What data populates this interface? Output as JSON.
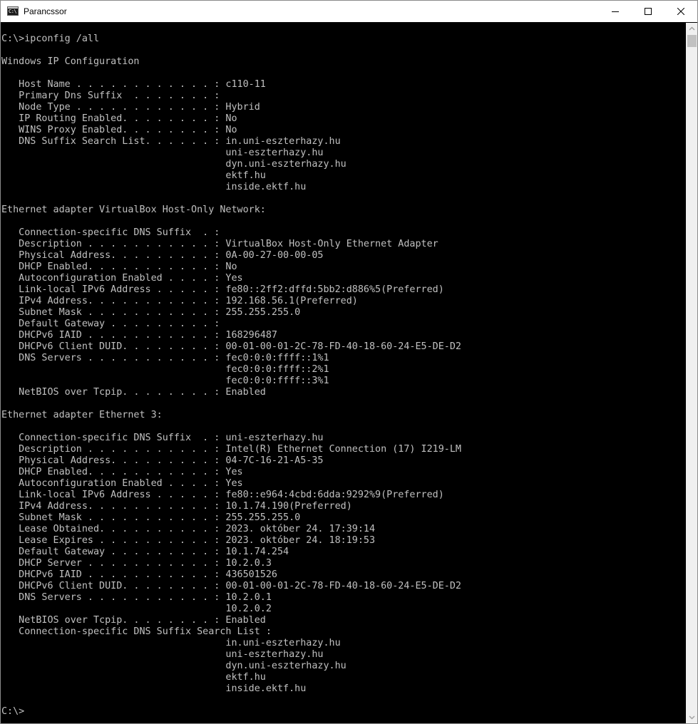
{
  "window": {
    "title": "Parancssor",
    "app_icon_glyph": "C:\\",
    "icons": {
      "minimize": "minimize-icon",
      "maximize": "maximize-icon",
      "close": "close-icon"
    }
  },
  "console": {
    "foreground": "#c0c0c0",
    "background": "#000000",
    "lines": [
      "C:\\>ipconfig /all",
      "",
      "Windows IP Configuration",
      "",
      "   Host Name . . . . . . . . . . . . : c110-11",
      "   Primary Dns Suffix  . . . . . . . : ",
      "   Node Type . . . . . . . . . . . . : Hybrid",
      "   IP Routing Enabled. . . . . . . . : No",
      "   WINS Proxy Enabled. . . . . . . . : No",
      "   DNS Suffix Search List. . . . . . : in.uni-eszterhazy.hu",
      "                                       uni-eszterhazy.hu",
      "                                       dyn.uni-eszterhazy.hu",
      "                                       ektf.hu",
      "                                       inside.ektf.hu",
      "",
      "Ethernet adapter VirtualBox Host-Only Network:",
      "",
      "   Connection-specific DNS Suffix  . : ",
      "   Description . . . . . . . . . . . : VirtualBox Host-Only Ethernet Adapter",
      "   Physical Address. . . . . . . . . : 0A-00-27-00-00-05",
      "   DHCP Enabled. . . . . . . . . . . : No",
      "   Autoconfiguration Enabled . . . . : Yes",
      "   Link-local IPv6 Address . . . . . : fe80::2ff2:dffd:5bb2:d886%5(Preferred)",
      "   IPv4 Address. . . . . . . . . . . : 192.168.56.1(Preferred)",
      "   Subnet Mask . . . . . . . . . . . : 255.255.255.0",
      "   Default Gateway . . . . . . . . . : ",
      "   DHCPv6 IAID . . . . . . . . . . . : 168296487",
      "   DHCPv6 Client DUID. . . . . . . . : 00-01-00-01-2C-78-FD-40-18-60-24-E5-DE-D2",
      "   DNS Servers . . . . . . . . . . . : fec0:0:0:ffff::1%1",
      "                                       fec0:0:0:ffff::2%1",
      "                                       fec0:0:0:ffff::3%1",
      "   NetBIOS over Tcpip. . . . . . . . : Enabled",
      "",
      "Ethernet adapter Ethernet 3:",
      "",
      "   Connection-specific DNS Suffix  . : uni-eszterhazy.hu",
      "   Description . . . . . . . . . . . : Intel(R) Ethernet Connection (17) I219-LM",
      "   Physical Address. . . . . . . . . : 04-7C-16-21-A5-35",
      "   DHCP Enabled. . . . . . . . . . . : Yes",
      "   Autoconfiguration Enabled . . . . : Yes",
      "   Link-local IPv6 Address . . . . . : fe80::e964:4cbd:6dda:9292%9(Preferred)",
      "   IPv4 Address. . . . . . . . . . . : 10.1.74.190(Preferred)",
      "   Subnet Mask . . . . . . . . . . . : 255.255.255.0",
      "   Lease Obtained. . . . . . . . . . : 2023. október 24. 17:39:14",
      "   Lease Expires . . . . . . . . . . : 2023. október 24. 18:19:53",
      "   Default Gateway . . . . . . . . . : 10.1.74.254",
      "   DHCP Server . . . . . . . . . . . : 10.2.0.3",
      "   DHCPv6 IAID . . . . . . . . . . . : 436501526",
      "   DHCPv6 Client DUID. . . . . . . . : 00-01-00-01-2C-78-FD-40-18-60-24-E5-DE-D2",
      "   DNS Servers . . . . . . . . . . . : 10.2.0.1",
      "                                       10.2.0.2",
      "   NetBIOS over Tcpip. . . . . . . . : Enabled",
      "   Connection-specific DNS Suffix Search List :",
      "                                       in.uni-eszterhazy.hu",
      "                                       uni-eszterhazy.hu",
      "                                       dyn.uni-eszterhazy.hu",
      "                                       ektf.hu",
      "                                       inside.ektf.hu",
      "",
      "C:\\>"
    ]
  }
}
